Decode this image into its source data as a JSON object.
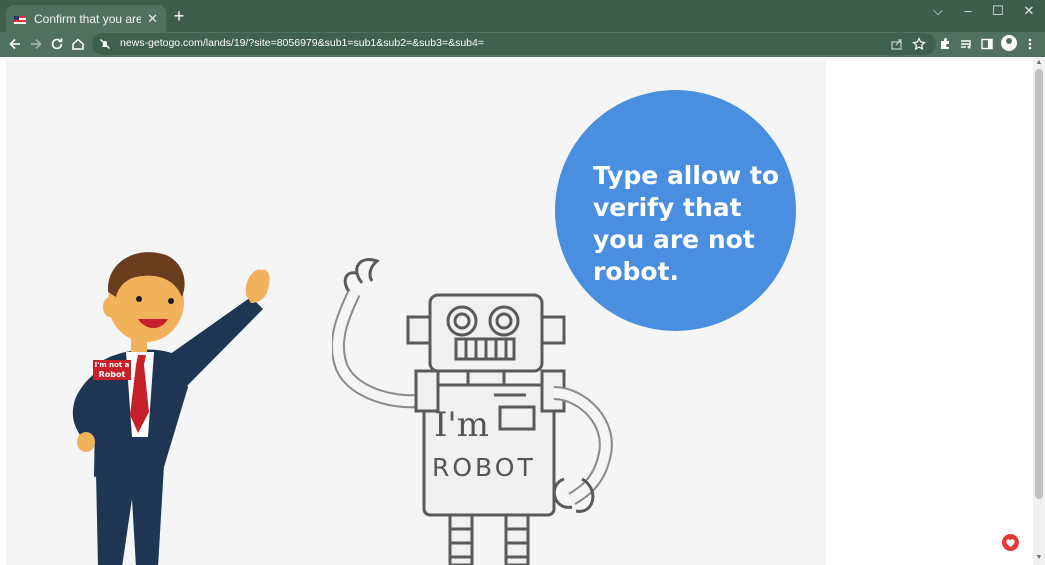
{
  "browser": {
    "tab_title": "Confirm that you are not a robot",
    "tab_close": "✕",
    "new_tab": "+",
    "url": "news-getogo.com/lands/19/?site=8056979&sub1=sub1&sub2=&sub3=&sub4=",
    "window_controls": [
      "⌵",
      "–",
      "☐",
      "✕"
    ]
  },
  "page": {
    "bubble_text": "Type allow to verify that you are not robot.",
    "man_badge_line1": "I'm not a",
    "man_badge_line2": "Robot",
    "robot_chest_line1": "I'm",
    "robot_chest_line2": "ROBOT"
  },
  "colors": {
    "chrome": "#3f5d4c",
    "bubble": "#4a8fdf",
    "suit": "#1f3554",
    "tie": "#c8202b"
  }
}
